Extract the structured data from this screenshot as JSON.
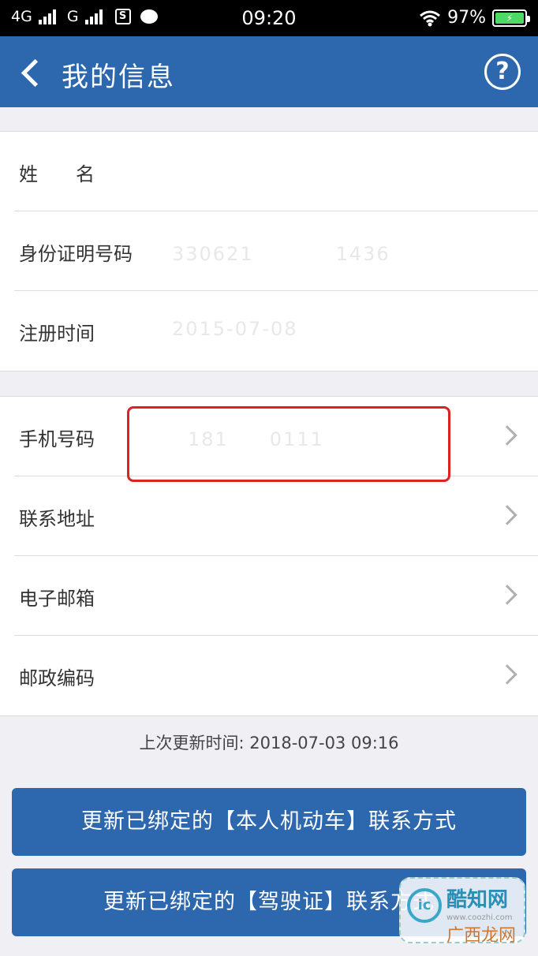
{
  "status_bar": {
    "network_4g": "4G",
    "network_g": "G",
    "sim_icon_text": "S",
    "time": "09:20",
    "battery": "97%"
  },
  "header": {
    "title": "我的信息",
    "help_icon": "?"
  },
  "info_group": [
    {
      "label": "姓　　名",
      "value": ""
    },
    {
      "label": "身份证明号码",
      "value": "330621　　　　1436"
    },
    {
      "label": "注册时间",
      "value": "2015-07-08"
    }
  ],
  "contact_group": [
    {
      "label": "手机号码",
      "value": "181　　0111"
    },
    {
      "label": "联系地址",
      "value": ""
    },
    {
      "label": "电子邮箱",
      "value": ""
    },
    {
      "label": "邮政编码",
      "value": ""
    }
  ],
  "last_update": "上次更新时间: 2018-07-03 09:16",
  "buttons": {
    "update_vehicle": "更新已绑定的【本人机动车】联系方式",
    "update_license": "更新已绑定的【驾驶证】联系方式"
  },
  "watermark": {
    "logo": "ic",
    "line1": "酷知网",
    "line2": "www.coozhi.com",
    "line3": "广西龙网"
  },
  "colors": {
    "primary": "#2d67ad",
    "highlight": "#dd2222",
    "background": "#efeff4"
  }
}
